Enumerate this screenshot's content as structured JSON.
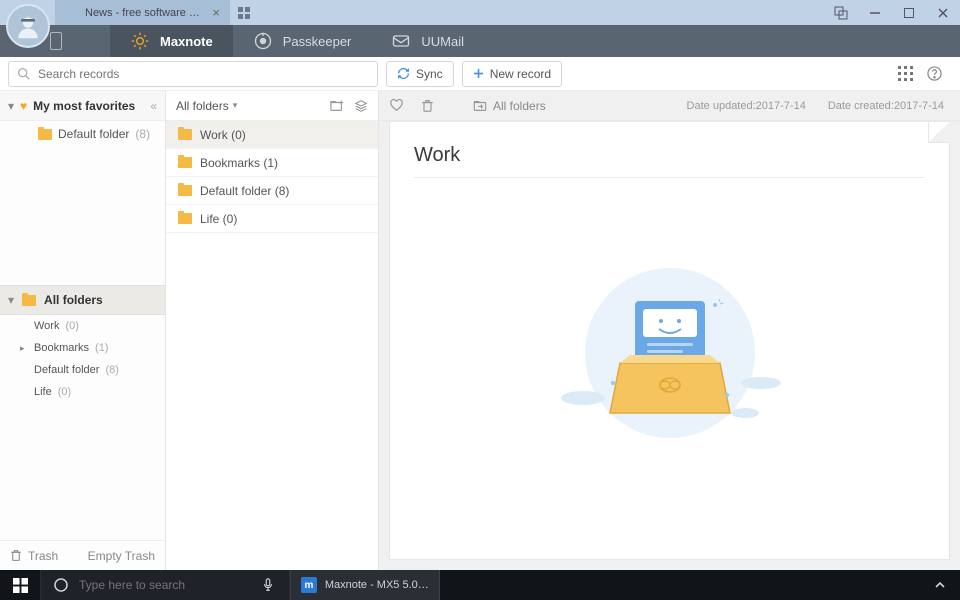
{
  "titlebar": {
    "tab_title": "News - free software downl...",
    "close_label": "×"
  },
  "nav": {
    "maxnote": "Maxnote",
    "passkeeper": "Passkeeper",
    "uumail": "UUMail"
  },
  "toolbar": {
    "search_placeholder": "Search records",
    "sync_label": "Sync",
    "new_record_label": "New record"
  },
  "left": {
    "favorites_label": "My most favorites",
    "default_folder": "Default folder",
    "default_folder_count": "(8)",
    "all_folders_label": "All folders",
    "items": [
      {
        "label": "Work",
        "count": "(0)",
        "has_children": false
      },
      {
        "label": "Bookmarks",
        "count": "(1)",
        "has_children": true
      },
      {
        "label": "Default folder",
        "count": "(8)",
        "has_children": false
      },
      {
        "label": "Life",
        "count": "(0)",
        "has_children": false
      }
    ],
    "trash_label": "Trash",
    "empty_trash_label": "Empty Trash"
  },
  "mid": {
    "header_label": "All folders",
    "items": [
      {
        "label": "Work (0)"
      },
      {
        "label": "Bookmarks (1)"
      },
      {
        "label": "Default folder (8)"
      },
      {
        "label": "Life (0)"
      }
    ]
  },
  "right": {
    "all_folders_label": "All folders",
    "date_updated": "Date updated:2017-7-14",
    "date_created": "Date created:2017-7-14",
    "doc_title": "Work"
  },
  "taskbar": {
    "search_placeholder": "Type here to search",
    "app_label": "Maxnote - MX5 5.0...."
  }
}
